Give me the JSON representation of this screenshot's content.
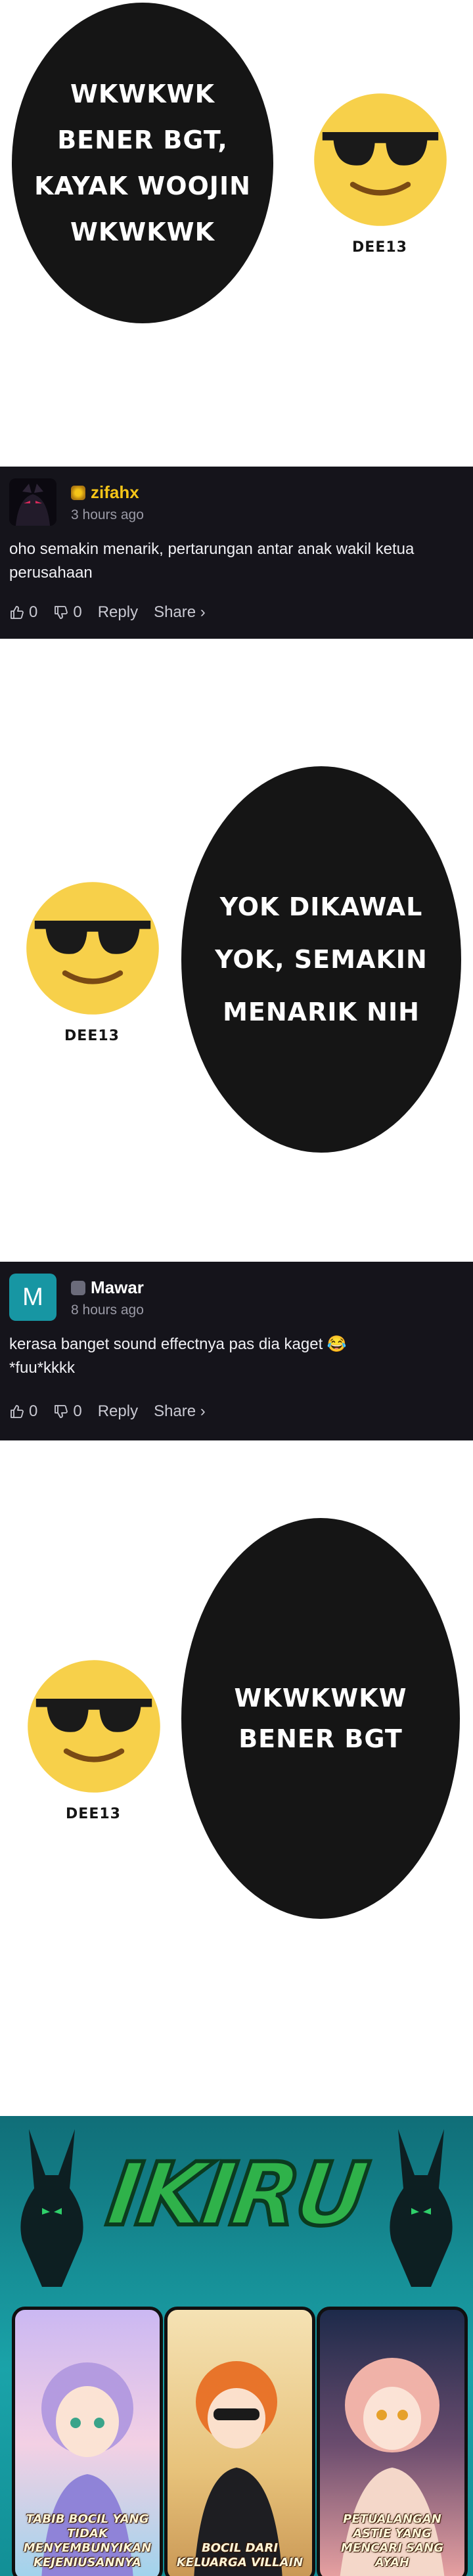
{
  "panels": [
    {
      "bubble": "WKWKWK\nBENER BGT,\nKAYAK WOOJIN\nWKWKWK",
      "credit": "DEE13"
    },
    {
      "bubble": "YOK DIKAWAL\nYOK, SEMAKIN\nMENARIK NIH",
      "credit": "DEE13"
    },
    {
      "bubble": "WKWKWKW\nBENER BGT",
      "credit": "DEE13"
    }
  ],
  "comments": [
    {
      "username": "zifahx",
      "time": "3 hours ago",
      "text": "oho semakin menarik, pertarungan antar anak wakil ketua perusahaan",
      "likes": "0",
      "dislikes": "0",
      "reply_label": "Reply",
      "share_label": "Share ›",
      "name_color": "#f5c518"
    },
    {
      "username": "Mawar",
      "avatar_letter": "M",
      "time": "8 hours ago",
      "text": "kerasa banget sound effectnya pas dia kaget 😂 *fuu*kkkk",
      "likes": "0",
      "dislikes": "0",
      "reply_label": "Reply",
      "share_label": "Share ›",
      "name_color": "#ffffff",
      "avatar_color": "#1796a3"
    }
  ],
  "banner": {
    "logo": "IKIRU",
    "cards": [
      {
        "title": "TABIB BOCIL YANG\nTIDAK MENYEMBUNYIKAN\nKEJENIUSANNYA"
      },
      {
        "title": "BOCIL DARI\nKELUARGA VILLAIN"
      },
      {
        "title": "PETUALANGAN ASTIE YANG\nMENCARI SANG AYAH"
      }
    ]
  }
}
